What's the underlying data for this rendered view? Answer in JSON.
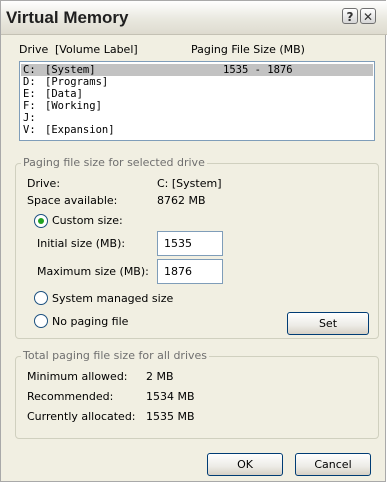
{
  "window": {
    "title": "Virtual Memory",
    "help_glyph": "?",
    "close_glyph": "✕"
  },
  "list_header": {
    "drive": "Drive",
    "volume_label": "[Volume Label]",
    "paging_size": "Paging File Size (MB)"
  },
  "drives": [
    {
      "letter": "C:",
      "label": "[System]",
      "size": "1535 - 1876",
      "selected": true
    },
    {
      "letter": "D:",
      "label": "[Programs]",
      "size": ""
    },
    {
      "letter": "E:",
      "label": "[Data]",
      "size": ""
    },
    {
      "letter": "F:",
      "label": "[Working]",
      "size": ""
    },
    {
      "letter": "J:",
      "label": "",
      "size": ""
    },
    {
      "letter": "V:",
      "label": "[Expansion]",
      "size": ""
    }
  ],
  "selected_group": {
    "legend": "Paging file size for selected drive",
    "drive_label": "Drive:",
    "drive_value": "C:  [System]",
    "space_label": "Space available:",
    "space_value": "8762 MB",
    "custom_size": "Custom size:",
    "initial_label": "Initial size (MB):",
    "initial_value": "1535",
    "maximum_label": "Maximum size (MB):",
    "maximum_value": "1876",
    "system_managed": "System managed size",
    "no_paging": "No paging file",
    "set_label": "Set",
    "selected_option": "custom"
  },
  "total_group": {
    "legend": "Total paging file size for all drives",
    "min_label": "Minimum allowed:",
    "min_value": "2 MB",
    "rec_label": "Recommended:",
    "rec_value": "1534 MB",
    "cur_label": "Currently allocated:",
    "cur_value": "1535 MB"
  },
  "footer": {
    "ok_label": "OK",
    "cancel_label": "Cancel"
  }
}
